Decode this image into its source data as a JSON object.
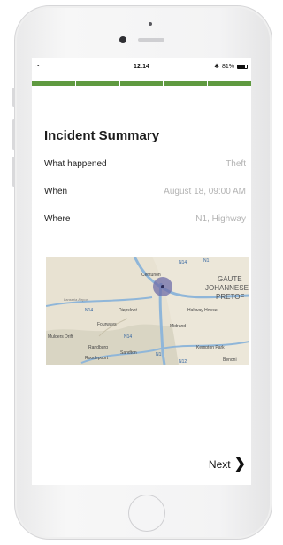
{
  "status_bar": {
    "time": "12:14",
    "battery_label": "81%",
    "battery_level": 0.81,
    "wifi_icon": "wifi-icon",
    "bluetooth_icon": "bluetooth-icon"
  },
  "progress": {
    "segments": 5,
    "color": "#5f9a40"
  },
  "summary": {
    "title": "Incident Summary",
    "rows": [
      {
        "label": "What happened",
        "value": "Theft"
      },
      {
        "label": "When",
        "value": "August 18, 09:00 AM"
      },
      {
        "label": "Where",
        "value": "N1, Highway"
      }
    ]
  },
  "map": {
    "place_labels": [
      "Centurion",
      "N14",
      "N1",
      "GAUTE",
      "JOHANNESE",
      "PRETOF",
      "Lanseria Airport",
      "N14",
      "Diepsloot",
      "Halfway House",
      "Fourways",
      "Midrand",
      "Roodepoort",
      "Randburg",
      "Sandton",
      "N1",
      "Kempton Park",
      "N12",
      "Benoni",
      "N14",
      "Mulders Drift"
    ],
    "marker_color": "#6f6ea8"
  },
  "footer": {
    "next_label": "Next"
  }
}
